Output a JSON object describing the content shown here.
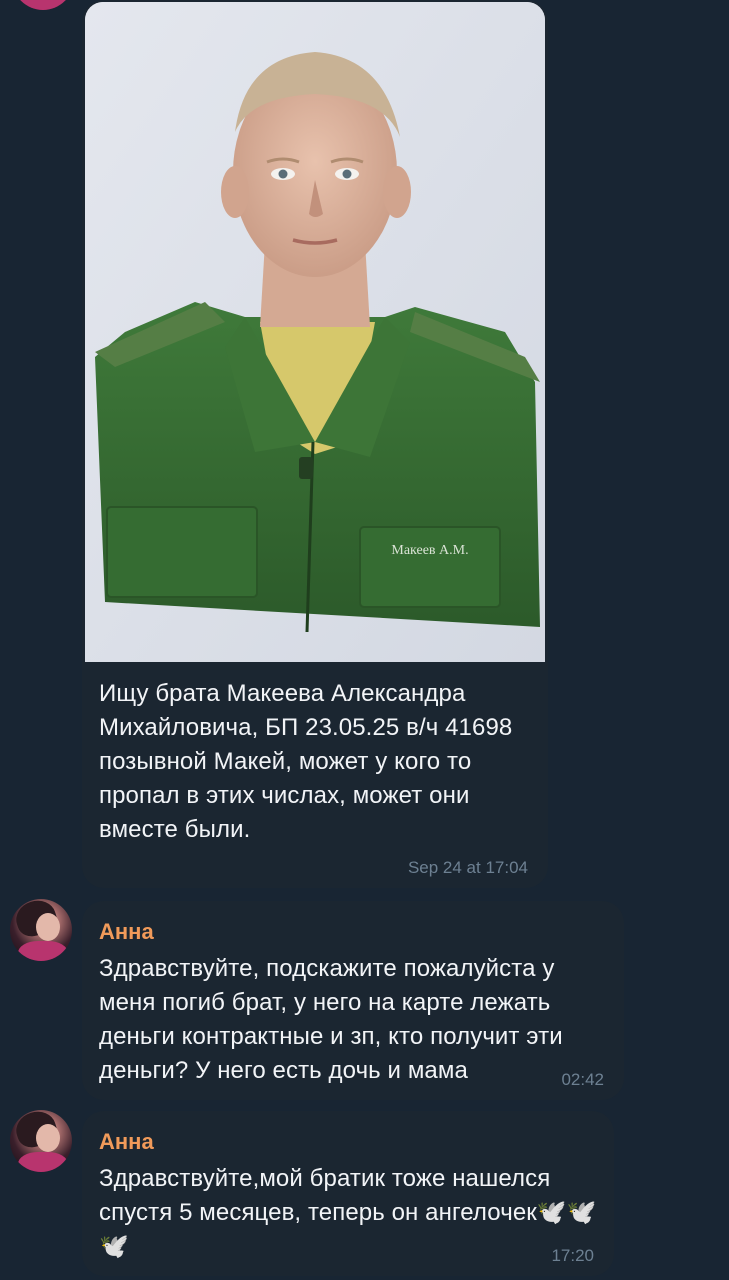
{
  "messages": [
    {
      "text": "Ищу брата Макеева Александра Михайловича, БП 23.05.25 в/ч 41698 позывной Макей, может у кого то пропал в этих числах, может они вместе были.",
      "time": "Sep 24 at 17:04",
      "photo": {
        "name_tag": "Макеев А.М."
      }
    },
    {
      "author": "Анна",
      "text": "Здравствуйте, подскажите пожалуйста у меня погиб брат, у него на карте лежать деньги контрактные и зп, кто получит эти деньги? У него есть дочь и мама",
      "time": "02:42"
    },
    {
      "author": "Анна",
      "text": "Здравствуйте,мой братик тоже нашелся спустя 5 месяцев, теперь он ангелочек🕊️🕊️🕊️",
      "time": "17:20"
    }
  ],
  "colors": {
    "background": "#182533",
    "bubble": "#1b2631",
    "author": "#f09a5a",
    "time": "#6d8092"
  }
}
